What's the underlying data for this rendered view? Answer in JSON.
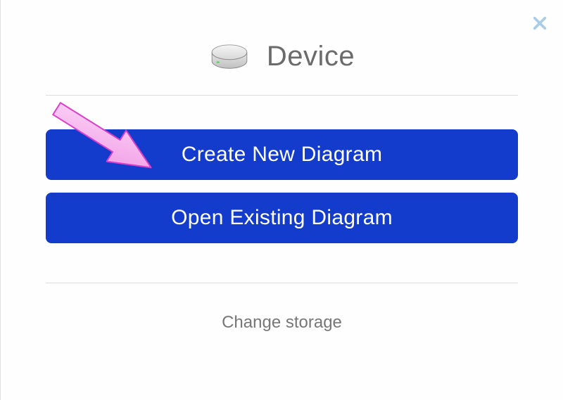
{
  "header": {
    "title": "Device",
    "icon_name": "hard-drive"
  },
  "buttons": {
    "create_label": "Create New Diagram",
    "open_label": "Open Existing Diagram"
  },
  "footer": {
    "change_storage_label": "Change storage"
  },
  "close_label": "Close"
}
